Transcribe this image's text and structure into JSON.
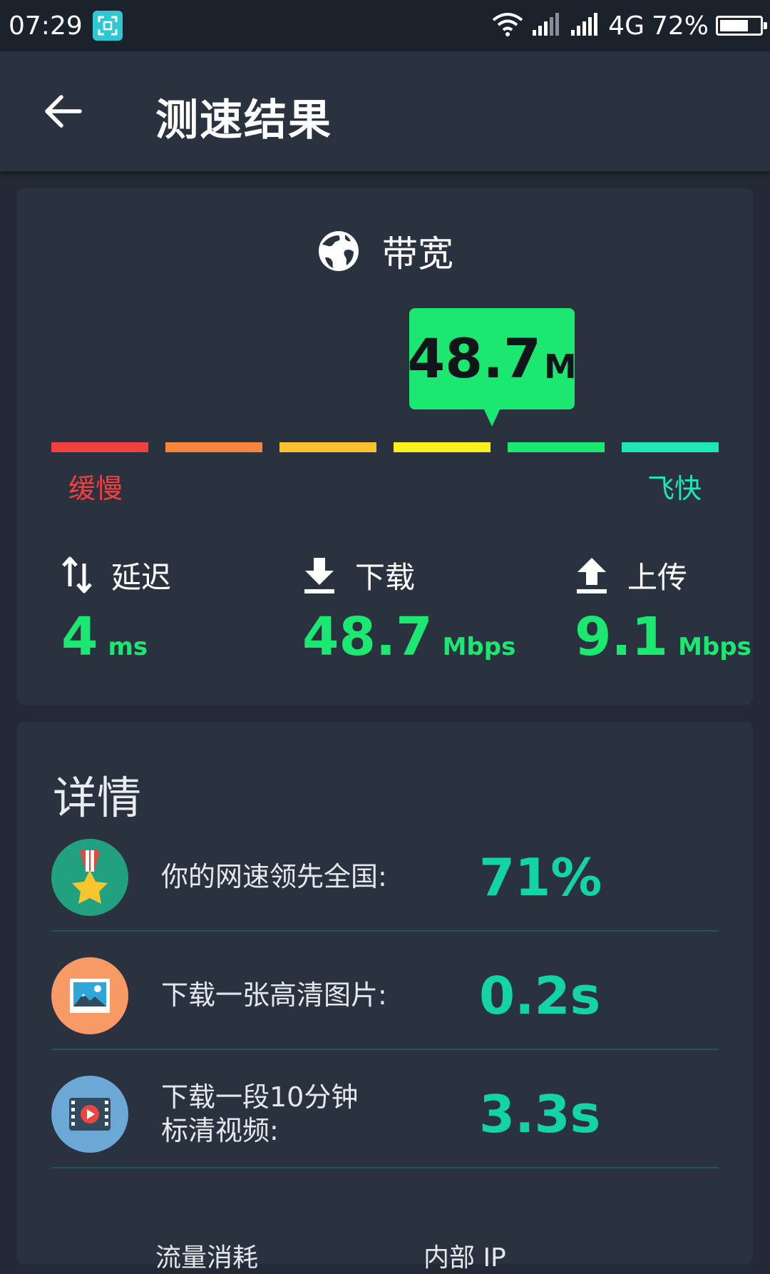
{
  "status_bar": {
    "time": "07:29",
    "network": "4G",
    "battery": "72%",
    "battery_level": 0.72
  },
  "app_bar": {
    "title": "测速结果"
  },
  "bandwidth": {
    "title": "带宽",
    "value": "48.7",
    "unit": "M",
    "scale_slow": "缓慢",
    "scale_fast": "飞快",
    "scale_colors": [
      "#f2403f",
      "#f7853c",
      "#fbc02d",
      "#f8f11e",
      "#1be870",
      "#1fe6b6"
    ]
  },
  "metrics": [
    {
      "label": "延迟",
      "value": "4",
      "unit": "ms"
    },
    {
      "label": "下载",
      "value": "48.7",
      "unit": "Mbps"
    },
    {
      "label": "上传",
      "value": "9.1",
      "unit": "Mbps"
    }
  ],
  "details": {
    "title": "详情",
    "rows": [
      {
        "label": "你的网速领先全国:",
        "value": "71%"
      },
      {
        "label": "下载一张高清图片:",
        "value": "0.2s"
      },
      {
        "label": "下载一段10分钟\n标清视频:",
        "value": "3.3s"
      }
    ],
    "footer_left": "流量消耗",
    "footer_right": "内部 IP"
  },
  "colors": {
    "accent_green": "#1be870",
    "accent_teal": "#13d4a6",
    "background": "#232a35",
    "card": "#2a3240"
  }
}
